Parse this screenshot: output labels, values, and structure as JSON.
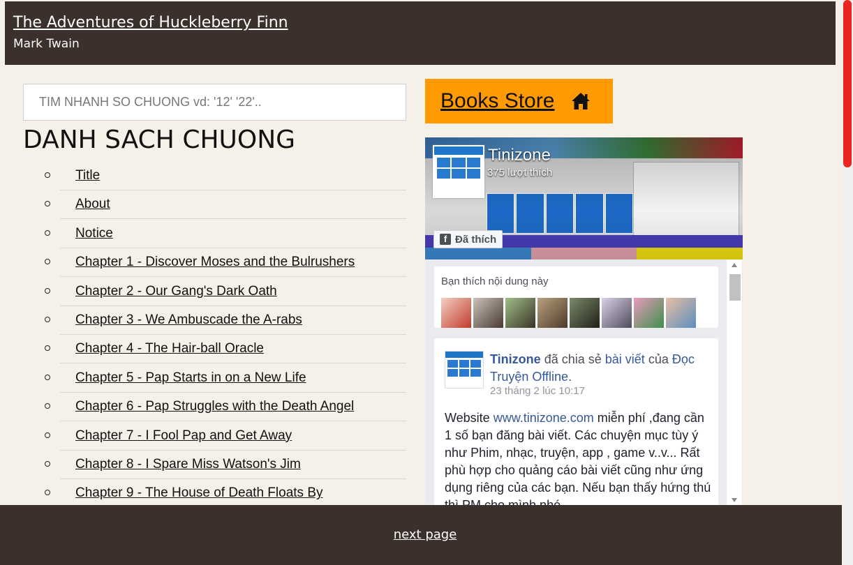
{
  "header": {
    "title": "The Adventures of Huckleberry Finn",
    "author": "Mark Twain"
  },
  "search": {
    "placeholder": "TIM NHANH SO CHUONG vd: '12' '22'.."
  },
  "chapters": {
    "heading": "DANH SACH CHUONG",
    "items": [
      "Title",
      "About",
      "Notice",
      "Chapter 1 - Discover Moses and the Bulrushers",
      "Chapter 2 - Our Gang's Dark Oath",
      "Chapter 3 - We Ambuscade the A-rabs",
      "Chapter 4 - The Hair-ball Oracle",
      "Chapter 5 - Pap Starts in on a New Life",
      "Chapter 6 - Pap Struggles with the Death Angel",
      "Chapter 7 - I Fool Pap and Get Away",
      "Chapter 8 - I Spare Miss Watson's Jim",
      "Chapter 9 - The House of Death Floats By"
    ]
  },
  "store": {
    "label": "Books Store",
    "icon": "home-icon"
  },
  "facebook": {
    "page_name": "Tinizone",
    "likes": "375 lượt thích",
    "liked_button": "Đã thích",
    "friends_like": "Bạn thích nội dung này",
    "post": {
      "author": "Tinizone",
      "shared_text": "đã chia sẻ",
      "post_link": "bài viết",
      "of_text": "của",
      "source": "Đọc Truyện Offline",
      "time": "23 tháng 2 lúc 10:17",
      "body_prefix": "Website ",
      "body_link": "www.tinizone.com",
      "body_text": " miễn phí ,đang cần 1 số bạn đăng bài viết. Các chuyện mục tùy ý như Phim, nhạc, truyện, app , game v..v... Rất phù hợp cho quảng cáo bài viết cũng như ứng dụng riêng của các bạn. Nếu bạn thấy hứng thú thì PM cho mình nhé"
    }
  },
  "footer": {
    "next": "next page"
  },
  "colors": {
    "header_bg": "#3b302b",
    "store_bg": "#ff9a00",
    "page_bg": "#f5f1e8",
    "scroll_accent": "#e8261f"
  }
}
